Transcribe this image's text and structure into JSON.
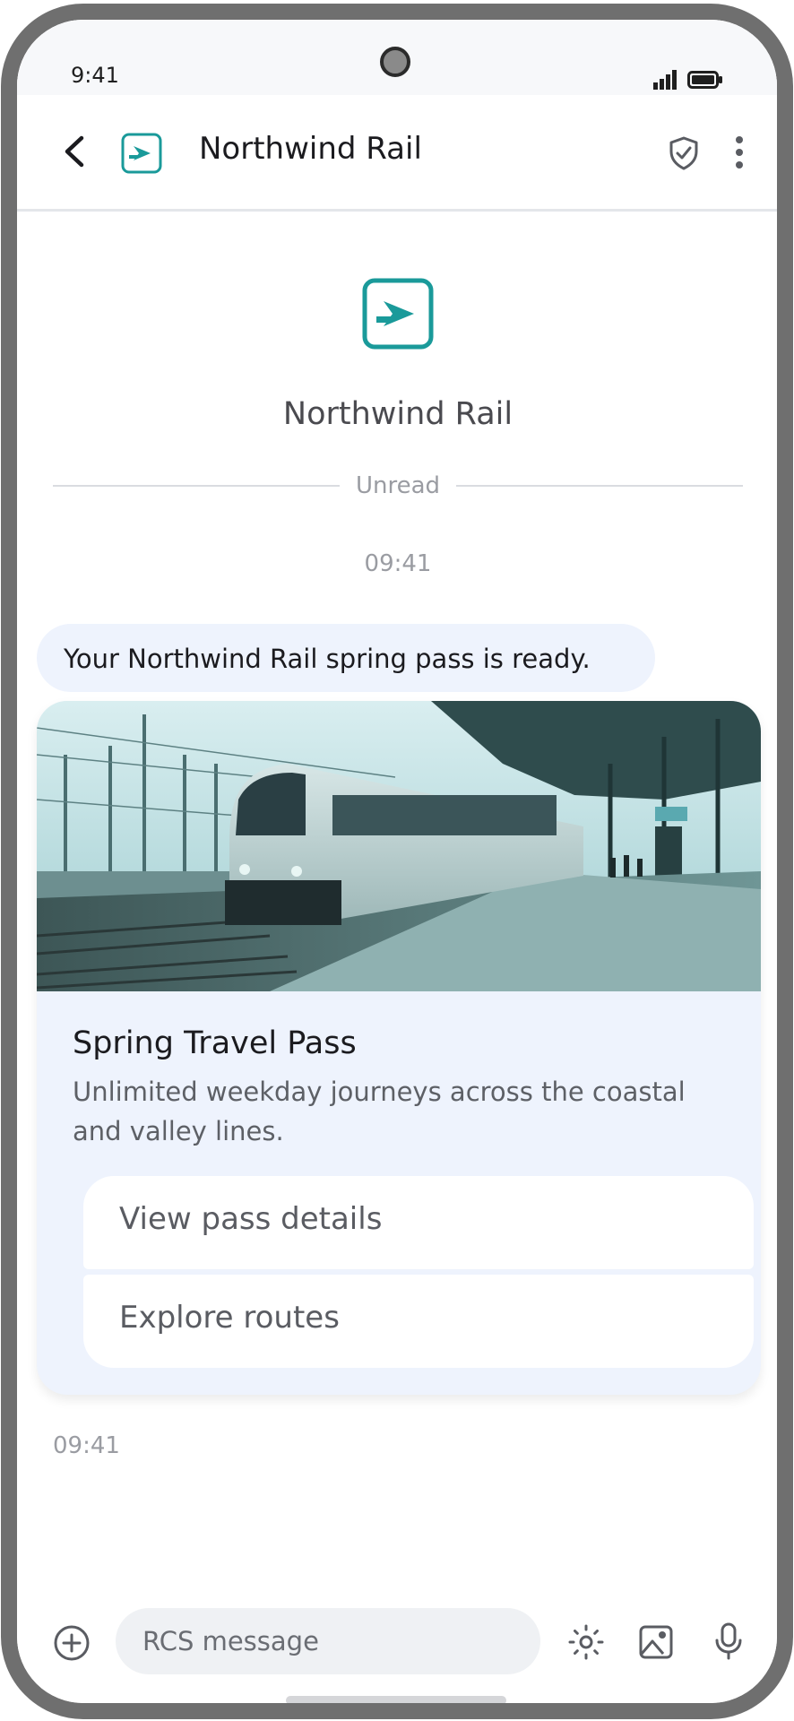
{
  "status_bar": {
    "time": "9:41"
  },
  "header": {
    "title": "Northwind Rail",
    "back_icon": "chevron-left-icon",
    "verified_icon": "shield-check-icon",
    "more_icon": "more-vertical-icon"
  },
  "profile": {
    "name": "Northwind Rail"
  },
  "conversation": {
    "unread_label": "Unread",
    "timestamp_top": "09:41",
    "message_text": "Your Northwind Rail spring pass is ready.",
    "timestamp_bottom": "09:41"
  },
  "rich_card": {
    "image_alt": "train at station platform",
    "title": "Spring Travel Pass",
    "description": "Unlimited weekday journeys across the coastal and valley lines.",
    "actions": [
      {
        "label": "View pass details"
      },
      {
        "label": "Explore routes"
      }
    ]
  },
  "composer": {
    "placeholder": "RCS message",
    "add_icon": "plus-circle-icon",
    "brightness_icon": "sun-icon",
    "image_icon": "image-icon",
    "mic_icon": "microphone-icon"
  },
  "colors": {
    "brand_teal": "#1a9a9a",
    "bubble_bg": "#eef3fd",
    "frame": "#6f6f6f"
  }
}
